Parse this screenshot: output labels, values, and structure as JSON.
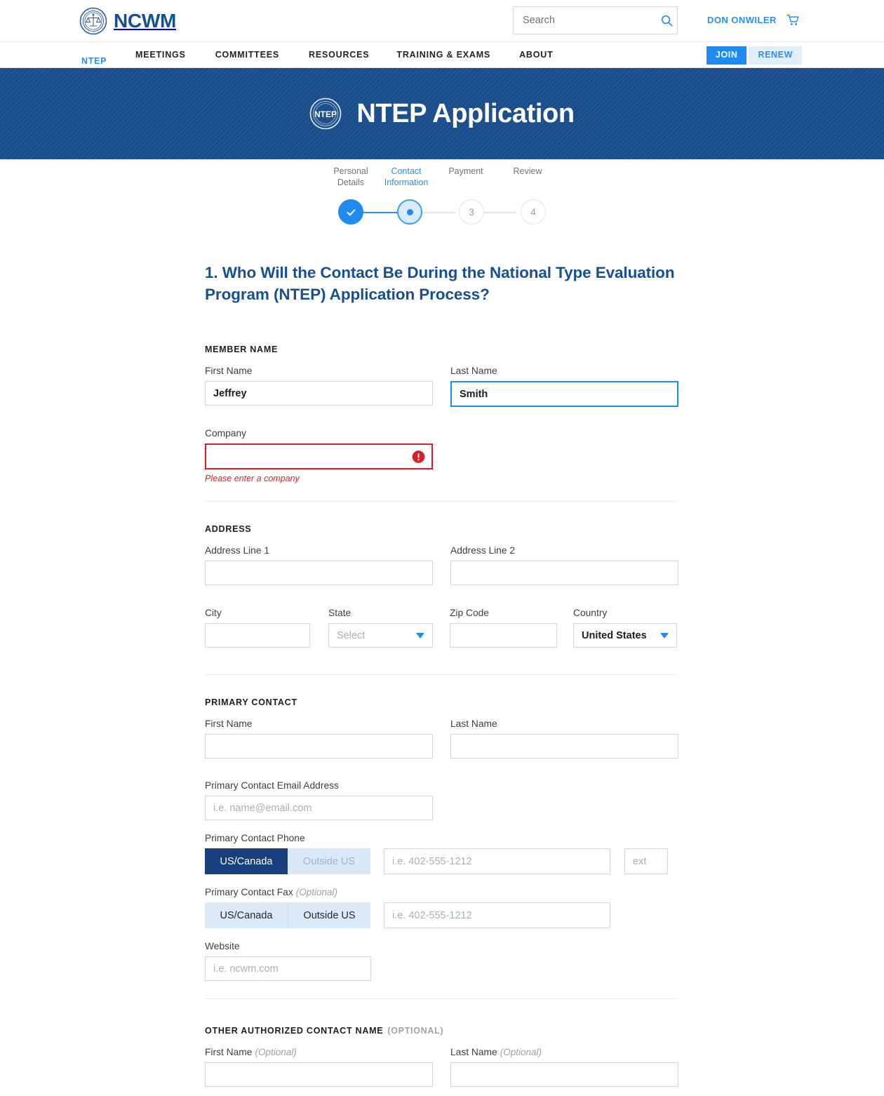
{
  "header": {
    "logo_text": "NCWM",
    "search": {
      "placeholder": "Search",
      "value": ""
    },
    "user_name": "DON ONWILER"
  },
  "nav": {
    "active": "NTEP",
    "links": [
      "MEETINGS",
      "COMMITTEES",
      "RESOURCES",
      "TRAINING & EXAMS",
      "ABOUT"
    ],
    "join_label": "JOIN",
    "renew_label": "RENEW"
  },
  "banner": {
    "title": "NTEP Application"
  },
  "stepper": {
    "steps": [
      {
        "label_line1": "Personal",
        "label_line2": "Details",
        "marker": "check",
        "state": "complete"
      },
      {
        "label_line1": "Contact",
        "label_line2": "Information",
        "marker": "dot",
        "state": "active"
      },
      {
        "label_line1": "Payment",
        "label_line2": "",
        "marker": "3",
        "state": "todo"
      },
      {
        "label_line1": "Review",
        "label_line2": "",
        "marker": "4",
        "state": "todo"
      }
    ]
  },
  "form": {
    "question_title": "1. Who Will the Contact Be During the National Type Evaluation Program (NTEP) Application Process?",
    "member_name": {
      "heading": "MEMBER NAME",
      "first_name_label": "First Name",
      "first_name_value": "Jeffrey",
      "last_name_label": "Last Name",
      "last_name_value": "Smith",
      "company_label": "Company",
      "company_value": "",
      "company_error": "Please enter a company"
    },
    "address": {
      "heading": "ADDRESS",
      "line1_label": "Address Line 1",
      "line1_value": "",
      "line2_label": "Address Line 2",
      "line2_value": "",
      "city_label": "City",
      "city_value": "",
      "state_label": "State",
      "state_value": "Select",
      "zip_label": "Zip Code",
      "zip_value": "",
      "country_label": "Country",
      "country_value": "United States"
    },
    "primary_contact": {
      "heading": "PRIMARY CONTACT",
      "first_name_label": "First Name",
      "first_name_value": "",
      "last_name_label": "Last Name",
      "last_name_value": "",
      "email_label": "Primary Contact Email Address",
      "email_placeholder": "i.e. name@email.com",
      "email_value": "",
      "phone_label": "Primary Contact Phone",
      "phone_us_label": "US/Canada",
      "phone_intl_label": "Outside US",
      "phone_placeholder": "i.e. 402-555-1212",
      "phone_value": "",
      "ext_placeholder": "ext",
      "ext_value": "",
      "fax_label": "Primary Contact Fax",
      "fax_optional": "(Optional)",
      "fax_us_label": "US/Canada",
      "fax_intl_label": "Outside US",
      "fax_placeholder": "i.e. 402-555-1212",
      "fax_value": "",
      "website_label": "Website",
      "website_placeholder": "i.e. ncwm.com",
      "website_value": ""
    },
    "other_contact": {
      "heading": "OTHER AUTHORIZED CONTACT NAME",
      "heading_optional": "(OPTIONAL)",
      "first_name_label": "First Name",
      "first_name_optional": "(Optional)",
      "first_name_value": "",
      "last_name_label": "Last Name",
      "last_name_optional": "(Optional)",
      "last_name_value": ""
    }
  },
  "colors": {
    "brand_navy": "#17508f",
    "accent_blue": "#1f8aef",
    "banner_blue": "#1a4f8f",
    "error_red": "#d81f2a",
    "toggle_active_navy": "#173f7c"
  }
}
